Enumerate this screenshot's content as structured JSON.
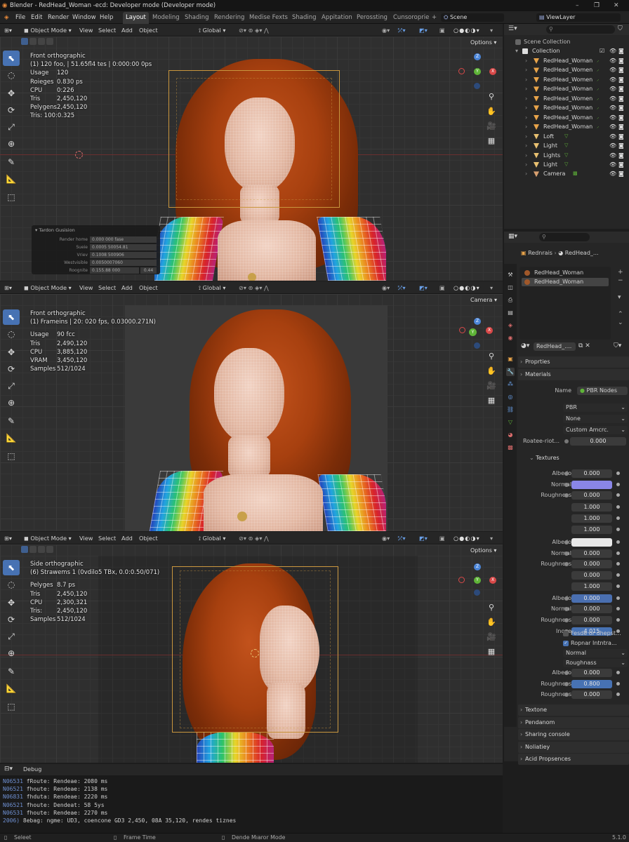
{
  "window": {
    "title": "Blender - RedHead_Woman -ecd: Developer mode (Developer mode)",
    "minimize": "–",
    "maximize": "❐",
    "close": "✕"
  },
  "menu": [
    "File",
    "Edit",
    "Render",
    "Window",
    "Help"
  ],
  "workspaces": [
    "Layout",
    "Modeling",
    "Shading",
    "Rendering",
    "Medise Fexts",
    "Shading",
    "Appitation",
    "Perossting",
    "Cunsoroprie"
  ],
  "workspace_add": "+",
  "scene": {
    "label": "Scene",
    "viewlayer": "ViewLayer"
  },
  "viewports": [
    {
      "mode": "Object Mode",
      "menus": [
        "View",
        "Select",
        "Add",
        "Object"
      ],
      "transform": "Global",
      "options": "Options",
      "info": [
        "Front orthographic",
        "(1) 120 foo, | 51.65fl4 tes | 0:000:00 0ps"
      ],
      "stats": [
        [
          "Usage",
          "120"
        ],
        [
          "Roieges",
          "0.830 ps"
        ],
        [
          "CPU",
          "0:226"
        ],
        [
          "Tris",
          "2,450,120"
        ],
        [
          "Pelygens",
          "2,450,120"
        ],
        [
          "Tris: 100:0.325",
          ""
        ]
      ],
      "panel": {
        "title": "Tardon Gusision",
        "rows": [
          [
            "Render home",
            "0.000 000 fase"
          ],
          [
            "Sueie",
            "0.0005 50054.81"
          ],
          [
            "Vriev",
            "0.1008 500906"
          ],
          [
            "Westvisible",
            "0.0050007060"
          ],
          [
            "Roognite",
            "0.155.88 000",
            ""
          ]
        ],
        "extra": "0.44"
      }
    },
    {
      "mode": "Object Mode",
      "menus": [
        "View",
        "Select",
        "Add",
        "Object"
      ],
      "transform": "Global",
      "options": "Camera",
      "info": [
        "Front orthographic",
        "(1) Frameins | 20: 020 fps, 0.03000.271N)"
      ],
      "stats": [
        [
          "Usage",
          "90 fcc"
        ],
        [
          "Tris",
          "2,490,120"
        ],
        [
          "CPU",
          "3,885,120"
        ],
        [
          "VRAM",
          "3,450,120"
        ],
        [
          "Samples",
          "512/1024"
        ]
      ]
    },
    {
      "mode": "Object Mode",
      "menus": [
        "View",
        "Select",
        "Add",
        "Object"
      ],
      "transform": "Global",
      "options": "Options",
      "info": [
        "Side orthographic",
        "(6) Strawems 1 (0vdilo5 TBx, 0.0:0.50/071)"
      ],
      "stats": [
        [
          "Pelyges",
          "8.7 ps"
        ],
        [
          "Tris",
          "2,450,120"
        ],
        [
          "CPU",
          "2,300,321"
        ],
        [
          "Tris:",
          "2,450,120"
        ],
        [
          "Samples",
          "512/1024"
        ]
      ]
    }
  ],
  "gizmo": {
    "z": "Z",
    "x": "X",
    "y": "Y"
  },
  "icons": {
    "select": "cursor-icon",
    "cursor": "3d-cursor-icon",
    "move": "move-icon",
    "rotate": "rotate-icon",
    "scale": "scale-icon",
    "transform": "transform-icon",
    "annotate": "annotate-icon",
    "measure": "measure-icon",
    "add": "add-cube-icon"
  },
  "outliner": {
    "root": "Scene Collection",
    "collection": "Collection",
    "items": [
      {
        "name": "RedHead_Woman",
        "type": "mesh"
      },
      {
        "name": "RedHead_Women",
        "type": "mesh"
      },
      {
        "name": "RedHead_Women",
        "type": "mesh"
      },
      {
        "name": "RedHead_Woman",
        "type": "mesh"
      },
      {
        "name": "RedHead_Women",
        "type": "mesh"
      },
      {
        "name": "RedHead_Woman",
        "type": "mesh"
      },
      {
        "name": "RedHead_Woman",
        "type": "mesh"
      },
      {
        "name": "RedHead_Woman",
        "type": "mesh"
      },
      {
        "name": "Loft",
        "type": "light"
      },
      {
        "name": "Light",
        "type": "light"
      },
      {
        "name": "Lights",
        "type": "light"
      },
      {
        "name": "Light",
        "type": "light"
      },
      {
        "name": "Camera",
        "type": "camera"
      }
    ]
  },
  "properties": {
    "breadcrumb": [
      "Rednrais",
      "RedHead_..."
    ],
    "slots": [
      "RedHead_Woman",
      "RedHead_Woman"
    ],
    "material_field": "RedHead_....",
    "sections_top": [
      "Proprties",
      "Materials"
    ],
    "name_label": "Name",
    "name_value": "PBR Nodes",
    "dropdowns": [
      "PBR",
      "None",
      "Custom Amcrc."
    ],
    "rotation": {
      "label": "Roatee-riot...",
      "value": "0.000"
    },
    "textures_label": "Textures",
    "rows": [
      {
        "label": "Albedo",
        "value": "0.000",
        "color": ""
      },
      {
        "label": "Normal",
        "value": "",
        "color": "#8a86e8"
      },
      {
        "label": "Roughness",
        "value": "0.000",
        "color": ""
      },
      {
        "label": "",
        "value": "1.000",
        "color": ""
      },
      {
        "label": "",
        "value": "1.000",
        "color": ""
      },
      {
        "label": "",
        "value": "1.000",
        "color": ""
      },
      {
        "label": "Albedo",
        "value": "",
        "color": "#e8e8e8"
      },
      {
        "label": "Normal",
        "value": "0.000",
        "color": ""
      },
      {
        "label": "Roughness",
        "value": "0.000",
        "color": ""
      },
      {
        "label": "",
        "value": "0.000",
        "color": ""
      },
      {
        "label": "",
        "value": "1.000",
        "color": ""
      },
      {
        "label": "Albedo",
        "value": "0.000",
        "color": "#4a6fb0"
      },
      {
        "label": "Normal",
        "value": "0.000",
        "color": ""
      },
      {
        "label": "Roughness",
        "value": "0.000",
        "color": ""
      },
      {
        "label": "Inove",
        "value": "4.015",
        "color": "#4772b3"
      }
    ],
    "checks": [
      {
        "label": "Fesde or dhepst...",
        "checked": false
      },
      {
        "label": "Ropnar Intntra...",
        "checked": true
      }
    ],
    "dropdowns2": [
      "Normal",
      "Roughnass"
    ],
    "rows2": [
      {
        "label": "Albedo",
        "value": "0.000",
        "color": ""
      },
      {
        "label": "Roughness",
        "value": "0.800",
        "color": "#4772b3"
      },
      {
        "label": "Roughness",
        "value": "0.000",
        "color": ""
      }
    ],
    "sections_bottom": [
      "Textone",
      "Pendanom",
      "Sharing console",
      "Noliatiey",
      "Acid Propsences"
    ]
  },
  "console": {
    "title": "Debug",
    "lines": [
      {
        "tag": "N06531",
        "text": "fRoute: Rendeae: 2080 ms"
      },
      {
        "tag": "N06521",
        "text": "fhoute: Rendeae: 2138 ms"
      },
      {
        "tag": "N06831",
        "text": "fhduta: Rendeae: 2220 ms"
      },
      {
        "tag": "N06521",
        "text": "fhoute: Dendeat: 58 5ys"
      },
      {
        "tag": "N06531",
        "text": "fhoute: Rendeae: 2270 ms"
      },
      {
        "tag": "2006)",
        "text": "8ebag: ngme: UD3, coencone GD3 2,450, 08A 35,120, rendes tiznes"
      }
    ]
  },
  "status": {
    "left": "Seleet",
    "mid": "Frame Time",
    "mode": "Dende Mıaror Mode",
    "right": "5.1.0"
  }
}
